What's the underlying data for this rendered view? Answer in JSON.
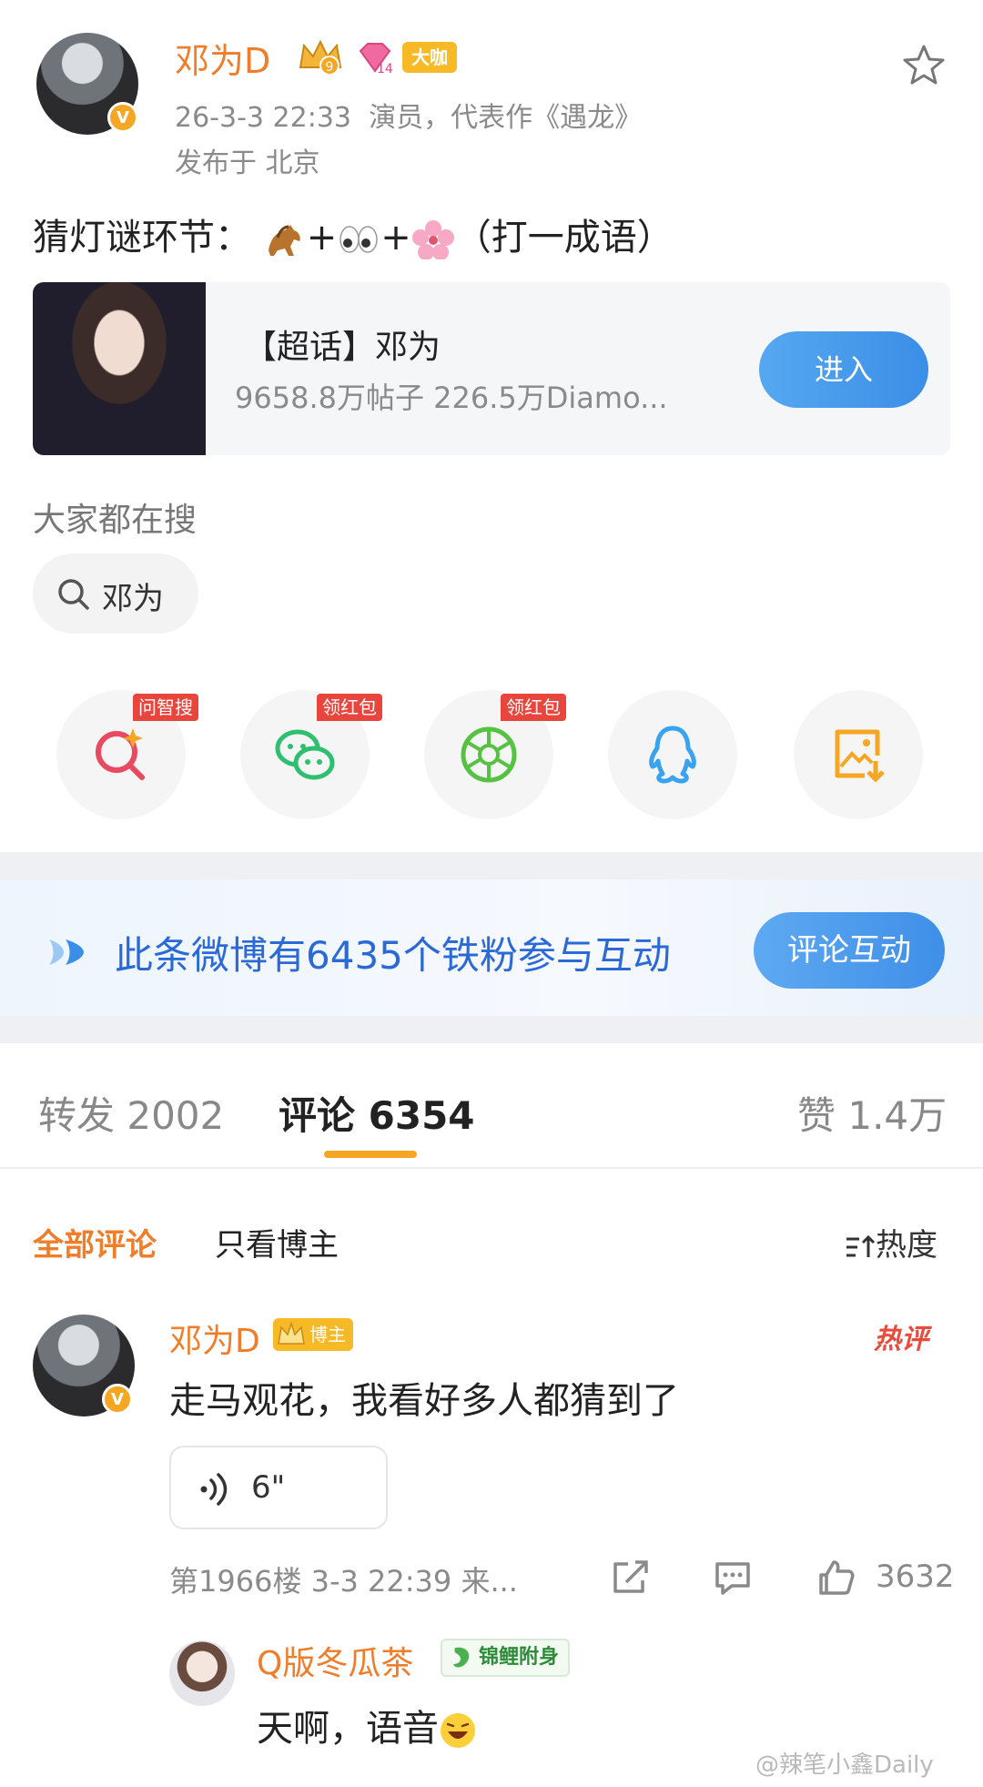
{
  "post": {
    "author": "邓为D",
    "level_badge": "大咖",
    "level_number": "14",
    "crown_number": "9",
    "time": "26-3-3 22:33",
    "bio": "演员，代表作《遇龙》",
    "location": "发布于 北京",
    "text_prefix": "猜灯谜环节：",
    "text_plus1": "+",
    "text_plus2": "+",
    "text_suffix": "（打一成语）"
  },
  "supertopic": {
    "title": "【超话】邓为",
    "stats": "9658.8万帖子 226.5万Diamo...",
    "enter_label": "进入"
  },
  "search": {
    "label": "大家都在搜",
    "chip": "邓为"
  },
  "share": {
    "tags": [
      "问智搜",
      "领红包",
      "领红包"
    ],
    "icons": [
      "ai-search-icon",
      "wechat-icon",
      "moments-icon",
      "qq-icon",
      "save-image-icon"
    ]
  },
  "fans": {
    "text": "此条微博有6435个铁粉参与互动",
    "button": "评论互动"
  },
  "tabs": {
    "repost": "转发 2002",
    "comments": "评论 6354",
    "likes": "赞 1.4万"
  },
  "filters": {
    "all": "全部评论",
    "author_only": "只看博主",
    "sort": "热度"
  },
  "comment": {
    "author": "邓为D",
    "host_badge": "博主",
    "hot_tag": "热评",
    "text": "走马观花，我看好多人都猜到了",
    "voice_duration": "6\"",
    "meta": "第1966楼 3-3 22:39 来...",
    "likes": "3632"
  },
  "reply": {
    "author": "Q版冬瓜茶",
    "badge": "锦鲤附身",
    "text": "天啊，语音"
  },
  "watermark": "@辣笔小鑫Daily",
  "colors": {
    "accent_orange": "#ef7d2a",
    "blue": "#3b8ee6",
    "gold": "#f7b926",
    "red": "#e8453c"
  }
}
